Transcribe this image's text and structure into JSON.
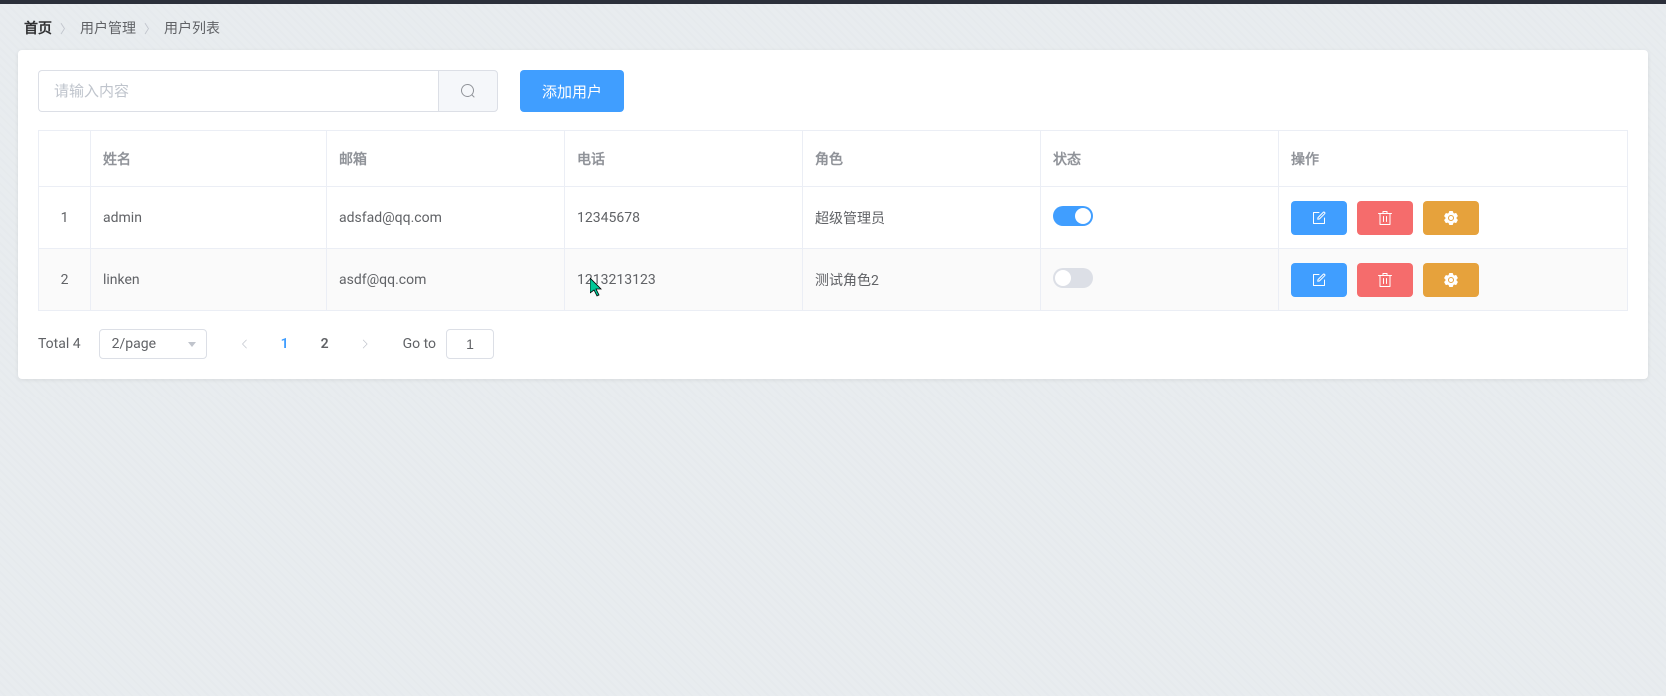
{
  "breadcrumb": {
    "home": "首页",
    "user_mgmt": "用户管理",
    "user_list": "用户列表"
  },
  "toolbar": {
    "search_placeholder": "请输入内容",
    "add_user_label": "添加用户"
  },
  "table": {
    "headers": {
      "index": "",
      "name": "姓名",
      "email": "邮箱",
      "phone": "电话",
      "role": "角色",
      "status": "状态",
      "action": "操作"
    },
    "rows": [
      {
        "index": "1",
        "name": "admin",
        "email": "adsfad@qq.com",
        "phone": "12345678",
        "role": "超级管理员",
        "status": true
      },
      {
        "index": "2",
        "name": "linken",
        "email": "asdf@qq.com",
        "phone": "1213213123",
        "role": "测试角色2",
        "status": false
      }
    ]
  },
  "pagination": {
    "total_label": "Total 4",
    "page_size": "2/page",
    "pages": [
      "1",
      "2"
    ],
    "current_page": "1",
    "goto_label": "Go to",
    "goto_value": "1"
  },
  "colors": {
    "primary": "#409eff",
    "danger": "#f56c6c",
    "warning": "#e6a23c"
  }
}
